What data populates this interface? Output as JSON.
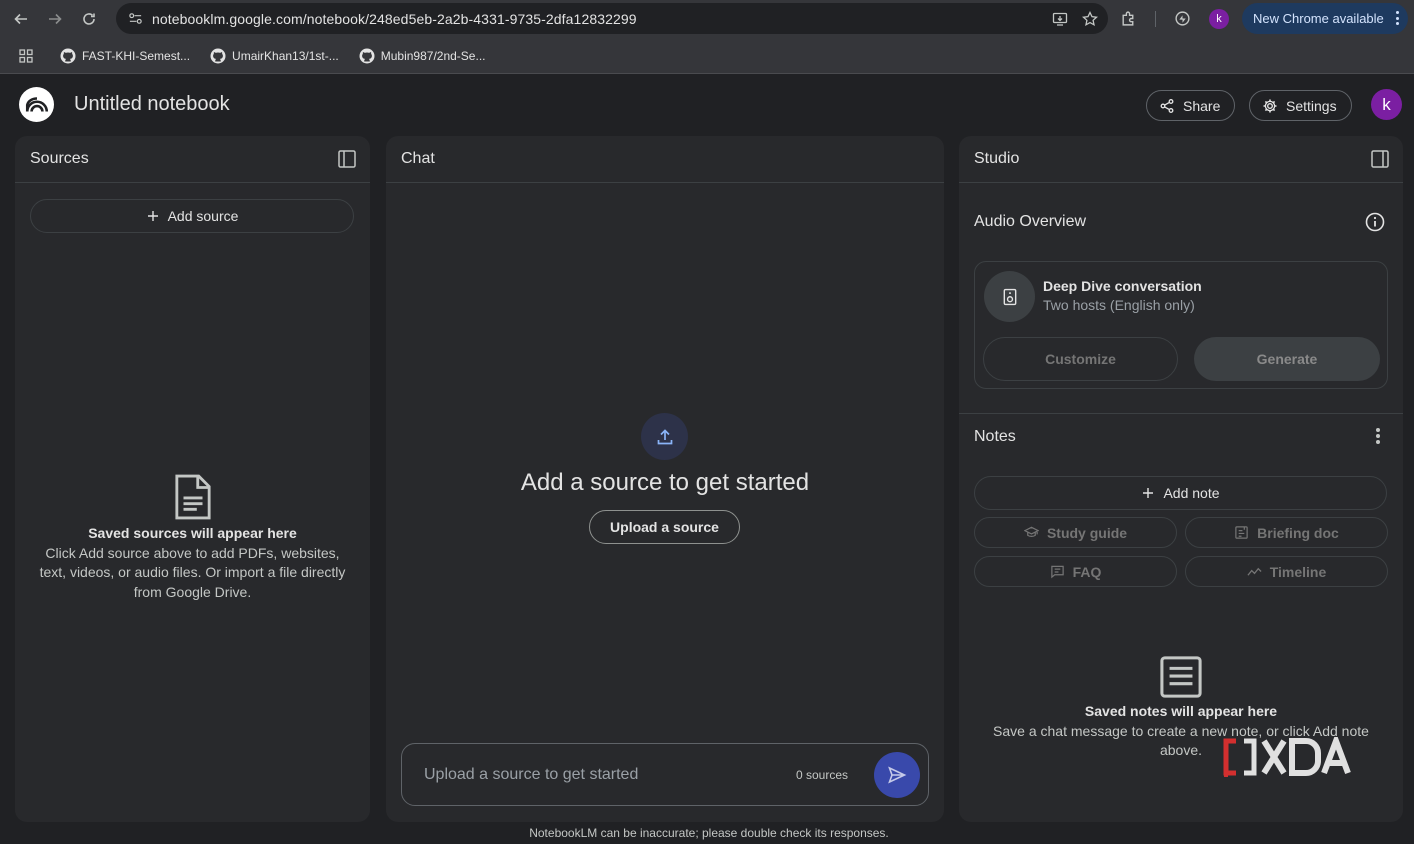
{
  "browser": {
    "url": "notebooklm.google.com/notebook/248ed5eb-2a2b-4331-9735-2dfa12832299",
    "profile_initial": "k",
    "update_label": "New Chrome available",
    "bookmarks": [
      {
        "label": "FAST-KHI-Semest..."
      },
      {
        "label": "UmairKhan13/1st-..."
      },
      {
        "label": "Mubin987/2nd-Se..."
      }
    ]
  },
  "header": {
    "title": "Untitled notebook",
    "share_label": "Share",
    "settings_label": "Settings",
    "avatar_initial": "k"
  },
  "sources": {
    "title": "Sources",
    "add_label": "Add source",
    "empty_title": "Saved sources will appear here",
    "empty_line1": "Click Add source above to add PDFs, websites,",
    "empty_line2": "text, videos, or audio files. Or import a file directly",
    "empty_line3": "from Google Drive."
  },
  "chat": {
    "title": "Chat",
    "headline": "Add a source to get started",
    "upload_label": "Upload a source",
    "input_placeholder": "Upload a source to get started",
    "source_count": "0 sources"
  },
  "studio": {
    "title": "Studio",
    "audio_title": "Audio Overview",
    "card_title": "Deep Dive conversation",
    "card_subtitle": "Two hosts (English only)",
    "customize_label": "Customize",
    "generate_label": "Generate",
    "notes_title": "Notes",
    "add_note_label": "Add note",
    "study_guide_label": "Study guide",
    "briefing_label": "Briefing doc",
    "faq_label": "FAQ",
    "timeline_label": "Timeline",
    "empty_title": "Saved notes will appear here",
    "empty_line1": "Save a chat message to create a new note, or click Add note",
    "empty_line2": "above."
  },
  "footer": {
    "disclaimer": "NotebookLM can be inaccurate; please double check its responses."
  },
  "colors": {
    "accent": "#3949ab",
    "background": "#202124",
    "panel": "#28292c",
    "avatar": "#7b1fa2"
  }
}
